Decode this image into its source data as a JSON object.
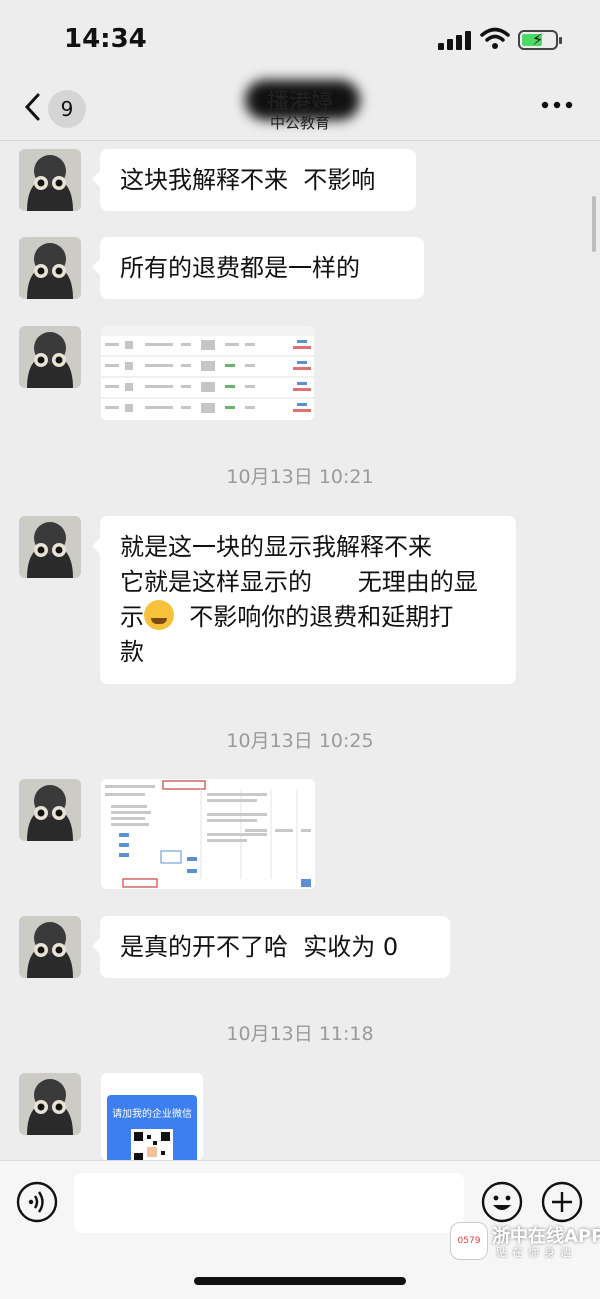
{
  "status_bar": {
    "time": "14:34"
  },
  "header": {
    "badge_count": "9",
    "contact_name": "播港婷",
    "contact_company": "中公教育"
  },
  "messages": [
    {
      "type": "text",
      "text": "这块我解释不来  不影响"
    },
    {
      "type": "text",
      "text": "所有的退费都是一样的"
    },
    {
      "type": "image",
      "description_icon": "refund-table-screenshot"
    },
    {
      "type": "timestamp",
      "text": "10月13日 10:21"
    },
    {
      "type": "text",
      "text_line1": "就是这一块的显示我解释不来",
      "text_line2": "它就是这样显示的      无理由的显",
      "text_line3_a": "示",
      "text_line3_b": "  不影响你的退费和延期打",
      "text_line4": "款"
    },
    {
      "type": "timestamp",
      "text": "10月13日 10:25"
    },
    {
      "type": "image",
      "description_icon": "order-detail-screenshot"
    },
    {
      "type": "text",
      "text": "是真的开不了哈  实收为 0"
    },
    {
      "type": "timestamp",
      "text": "10月13日 11:18"
    },
    {
      "type": "image",
      "card_title": "请加我的企业微信"
    }
  ],
  "watermark": {
    "title": "浙中在线APP",
    "subtitle": "贴在你身边",
    "logo": "0579"
  },
  "colors": {
    "background": "#ededed",
    "bubble": "#ffffff",
    "timestamp": "#9a9a9a"
  }
}
